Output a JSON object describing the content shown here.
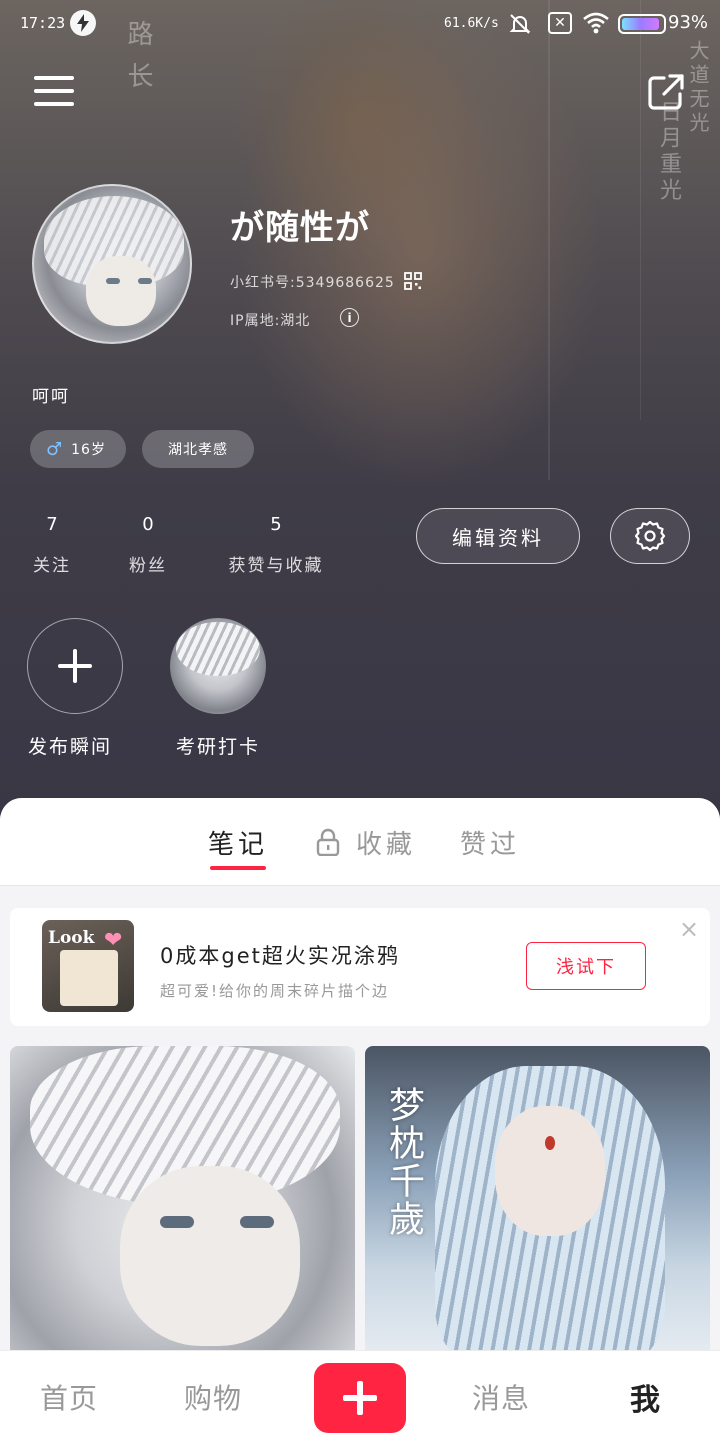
{
  "status_bar": {
    "time": "17:23",
    "network_speed": "61.6K/s",
    "battery_percent": "93%",
    "battery_level": 0.93
  },
  "profile": {
    "nickname": "が随性が",
    "xhs_id": "小红书号:5349686625",
    "ip_location": "IP属地:湖北",
    "bio": "呵呵",
    "tags": {
      "age": "16岁",
      "location": "湖北孝感"
    },
    "stats": [
      {
        "value": "7",
        "label": "关注"
      },
      {
        "value": "0",
        "label": "粉丝"
      },
      {
        "value": "5",
        "label": "获赞与收藏"
      }
    ],
    "edit_label": "编辑资料"
  },
  "moments": [
    {
      "label": "发布瞬间"
    },
    {
      "label": "考研打卡"
    }
  ],
  "tabs": [
    {
      "label": "笔记",
      "active": true
    },
    {
      "label": "收藏",
      "locked": true
    },
    {
      "label": "赞过"
    }
  ],
  "promo": {
    "thumb_text": "Look",
    "title": "0成本get超火实况涂鸦",
    "subtitle": "超可爱!给你的周末碎片描个边",
    "button_label": "浅试下"
  },
  "cards": [
    {
      "name": "note-card-1"
    },
    {
      "name": "note-card-2",
      "overlay_text": "梦枕千歲"
    }
  ],
  "bottom_nav": [
    {
      "label": "首页"
    },
    {
      "label": "购物"
    },
    {
      "label": "消息"
    },
    {
      "label": "我",
      "active": true
    }
  ],
  "colors": {
    "accent": "#ff2442",
    "male_icon": "#7fc4ff"
  }
}
